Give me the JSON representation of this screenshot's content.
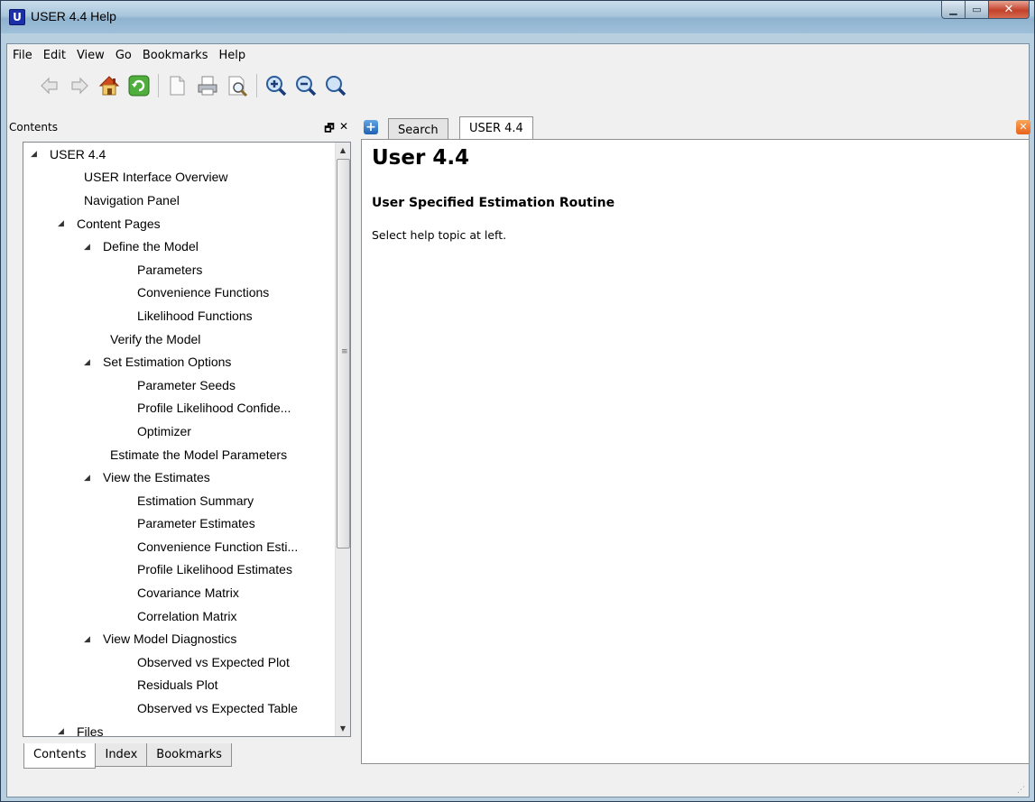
{
  "window": {
    "title": "USER 4.4 Help",
    "app_icon_letter": "U"
  },
  "menu": [
    "File",
    "Edit",
    "View",
    "Go",
    "Bookmarks",
    "Help"
  ],
  "toolbar": {
    "icons": [
      "back-arrow-icon",
      "forward-arrow-icon",
      "home-icon",
      "sync-icon",
      "copy-icon",
      "print-icon",
      "find-icon",
      "zoom-in-icon",
      "zoom-out-icon",
      "zoom-reset-icon"
    ]
  },
  "dock": {
    "title": "Contents",
    "float_glyph": "🗗",
    "close_glyph": "✕"
  },
  "tree": [
    {
      "label": "USER 4.4",
      "level": 0,
      "expanded": true
    },
    {
      "label": "USER Interface Overview",
      "level": 1
    },
    {
      "label": "Navigation Panel",
      "level": 1
    },
    {
      "label": "Content Pages",
      "level": 1,
      "expanded": true
    },
    {
      "label": "Define the Model",
      "level": 2,
      "expanded": true
    },
    {
      "label": "Parameters",
      "level": 3
    },
    {
      "label": "Convenience Functions",
      "level": 3
    },
    {
      "label": "Likelihood Functions",
      "level": 3
    },
    {
      "label": "Verify the Model",
      "level": 2
    },
    {
      "label": "Set Estimation Options",
      "level": 2,
      "expanded": true
    },
    {
      "label": "Parameter Seeds",
      "level": 3
    },
    {
      "label": "Profile Likelihood Confide...",
      "level": 3
    },
    {
      "label": "Optimizer",
      "level": 3
    },
    {
      "label": "Estimate the Model Parameters",
      "level": 2
    },
    {
      "label": "View the Estimates",
      "level": 2,
      "expanded": true
    },
    {
      "label": "Estimation Summary",
      "level": 3
    },
    {
      "label": "Parameter Estimates",
      "level": 3
    },
    {
      "label": "Convenience Function Esti...",
      "level": 3
    },
    {
      "label": "Profile Likelihood Estimates",
      "level": 3
    },
    {
      "label": "Covariance Matrix",
      "level": 3
    },
    {
      "label": "Correlation Matrix",
      "level": 3
    },
    {
      "label": "View Model Diagnostics",
      "level": 2,
      "expanded": true
    },
    {
      "label": "Observed vs Expected Plot",
      "level": 3
    },
    {
      "label": "Residuals Plot",
      "level": 3
    },
    {
      "label": "Observed vs Expected Table",
      "level": 3
    },
    {
      "label": "Files",
      "level": 1,
      "expanded": true
    }
  ],
  "bottom_tabs": [
    "Contents",
    "Index",
    "Bookmarks"
  ],
  "content_tabs": {
    "add_glyph": "+",
    "close_glyph": "✕",
    "tabs": [
      "Search",
      "USER 4.4"
    ]
  },
  "page": {
    "heading": "User 4.4",
    "subheading": "User Specified Estimation Routine",
    "body": "Select help topic at left."
  }
}
